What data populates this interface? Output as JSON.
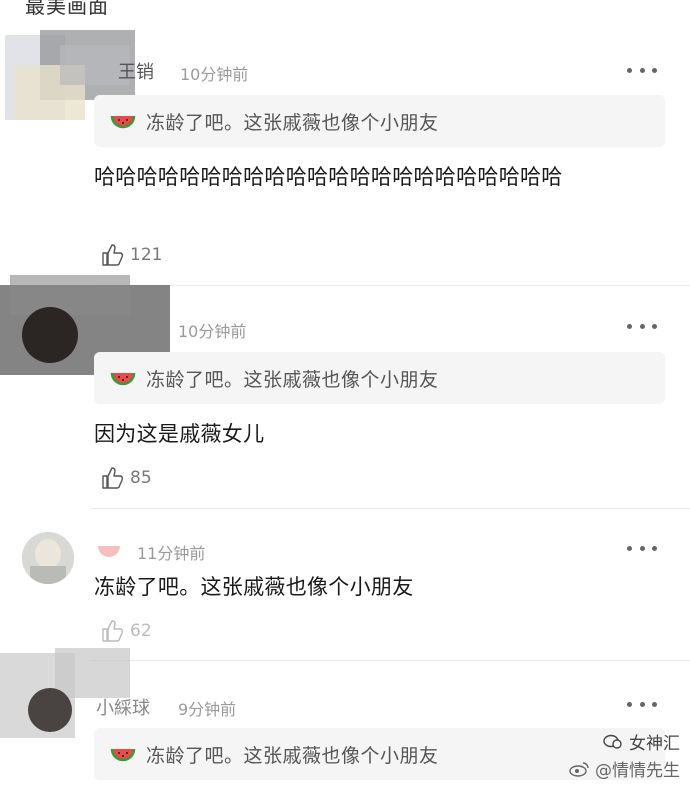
{
  "header_fragment": "最美画面",
  "comments": [
    {
      "username": "王销",
      "time": "10分钟前",
      "quote": "冻龄了吧。这张戚薇也像个小朋友",
      "text": "哈哈哈哈哈哈哈哈哈哈哈哈哈哈哈哈哈哈哈哈哈哈",
      "likes": "121"
    },
    {
      "username": "",
      "time": "10分钟前",
      "quote": "冻龄了吧。这张戚薇也像个小朋友",
      "text": "因为这是戚薇女儿",
      "likes": "85"
    },
    {
      "username": "",
      "time": "11分钟前",
      "text": "冻龄了吧。这张戚薇也像个小朋友",
      "likes": "62"
    },
    {
      "username": "小綵球",
      "time": "9分钟前",
      "quote": "冻龄了吧。这张戚薇也像个小朋友"
    }
  ],
  "watermark": {
    "line1": "女神汇",
    "line2": "@情情先生"
  },
  "icons": {
    "more": "more-dots-icon",
    "like": "thumbs-up-icon",
    "quote": "watermelon-icon",
    "weibo": "weibo-logo-icon"
  }
}
